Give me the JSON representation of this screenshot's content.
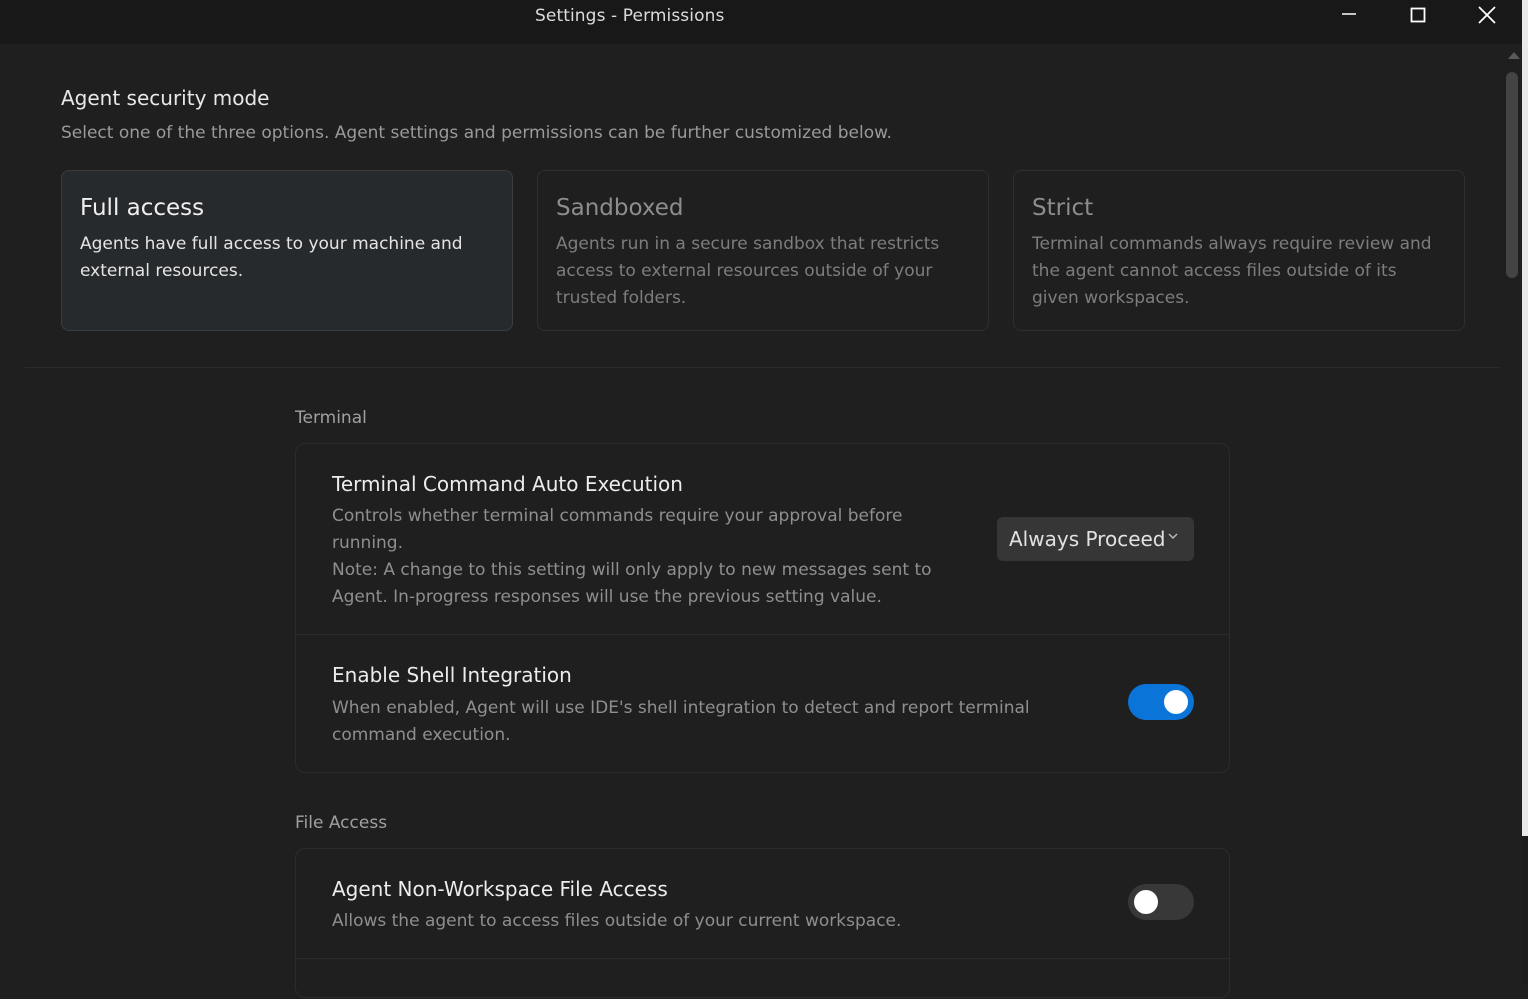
{
  "window": {
    "title": "Settings - Permissions",
    "controls": [
      "minimize-icon",
      "maximize-icon",
      "close-icon"
    ]
  },
  "security": {
    "title": "Agent security mode",
    "description": "Select one of the three options. Agent settings and permissions can be further customized below.",
    "selected": "Full access",
    "modes": [
      {
        "title": "Full access",
        "description": "Agents have full access to your machine and external resources."
      },
      {
        "title": "Sandboxed",
        "description": "Agents run in a secure sandbox that restricts access to external resources outside of your trusted folders."
      },
      {
        "title": "Strict",
        "description": "Terminal commands always require review and the agent cannot access files outside of its given workspaces."
      }
    ]
  },
  "terminal": {
    "label": "Terminal",
    "auto_execution": {
      "title": "Terminal Command Auto Execution",
      "description": "Controls whether terminal commands require your approval before running.",
      "note": "Note: A change to this setting will only apply to new messages sent to Agent. In-progress responses will use the previous setting value.",
      "value": "Always Proceed"
    },
    "shell_integration": {
      "title": "Enable Shell Integration",
      "description": "When enabled, Agent will use IDE's shell integration to detect and report terminal command execution.",
      "enabled": true
    }
  },
  "file_access": {
    "label": "File Access",
    "non_workspace": {
      "title": "Agent Non-Workspace File Access",
      "description": "Allows the agent to access files outside of your current workspace.",
      "enabled": false
    }
  },
  "colors": {
    "background": "#1f1f1f",
    "titlebar": "#181818",
    "accent": "#0a74d8",
    "selected_card": "#272a2c"
  }
}
